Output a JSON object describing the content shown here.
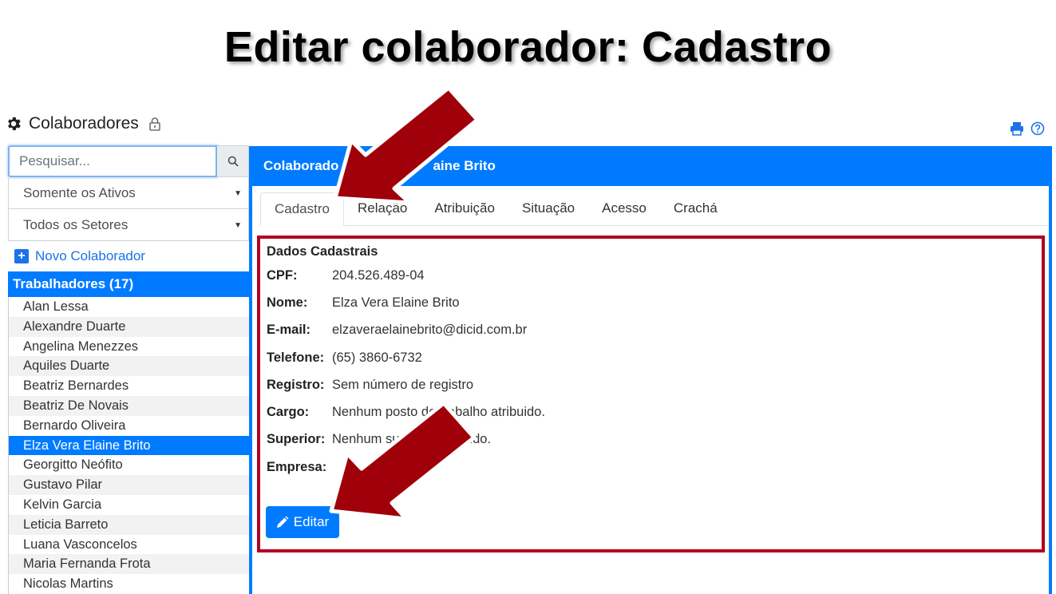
{
  "slide": {
    "title": "Editar colaborador: Cadastro"
  },
  "header": {
    "title": "Colaboradores",
    "icon": "gear-icon",
    "lock_icon": "lock-icon"
  },
  "top_tools": {
    "print_icon": "printer-icon",
    "help_icon": "help-icon"
  },
  "sidebar": {
    "search_placeholder": "Pesquisar...",
    "filter_status": "Somente os Ativos",
    "filter_sector": "Todos os Setores",
    "new_button": "Novo Colaborador",
    "list_title": "Trabalhadores (17)",
    "workers": [
      "Alan Lessa",
      "Alexandre Duarte",
      "Angelina Menezzes",
      "Aquiles Duarte",
      "Beatriz Bernardes",
      "Beatriz De Novais",
      "Bernardo Oliveira",
      "Elza Vera Elaine Brito",
      "Georgitto Neófito",
      "Gustavo Pilar",
      "Kelvin Garcia",
      "Leticia Barreto",
      "Luana Vasconcelos",
      "Maria Fernanda Frota",
      "Nicolas Martins"
    ],
    "selected_worker": "Elza Vera Elaine Brito"
  },
  "panel": {
    "title_left": "Colaborado",
    "title_right": "aine Brito",
    "tabs": [
      "Cadastro",
      "Relação",
      "Atribuição",
      "Situação",
      "Acesso",
      "Crachá"
    ],
    "active_tab": "Cadastro"
  },
  "details": {
    "section_title": "Dados Cadastrais",
    "fields": [
      {
        "label": "CPF:",
        "value": "204.526.489-04"
      },
      {
        "label": "Nome:",
        "value": "Elza Vera Elaine Brito"
      },
      {
        "label": "E-mail:",
        "value": "elzaveraelainebrito@dicid.com.br"
      },
      {
        "label": "Telefone:",
        "value": "(65) 3860-6732"
      },
      {
        "label": "Registro:",
        "value": "Sem número de registro"
      },
      {
        "label": "Cargo:",
        "value": "Nenhum posto de trabalho atribuido."
      },
      {
        "label": "Superior:",
        "value": "Nenhum superior atribuido."
      },
      {
        "label": "Empresa:",
        "value": ""
      }
    ],
    "edit_button": "Editar"
  },
  "colors": {
    "primary": "#007bff",
    "highlight": "#b00020",
    "arrow": "#a0000a"
  }
}
